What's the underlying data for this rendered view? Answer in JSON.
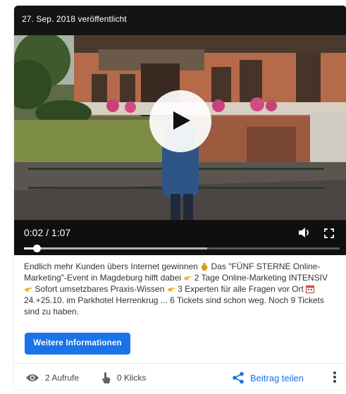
{
  "post": {
    "date_label": "27. Sep. 2018 veröffentlicht",
    "description_parts": {
      "p1": "Endlich mehr Kunden übers Internet gewinnen",
      "p2": "Das \"FÜNF STERNE Online-Marketing\"-Event in Magdeburg hilft dabei",
      "p3": "2 Tage Online-Marketing INTENSIV",
      "p4": "Sofort umsetzbares Praxis-Wissen",
      "p5": "3 Experten für alle Fragen vor Ort",
      "p6": "24.+25.10. im Parkhotel Herrenkrug ... 6 Tickets sind schon weg. Noch 9 Tickets sind zu haben."
    },
    "cta_label": "Weitere Informationen"
  },
  "video": {
    "timecode": "0:02 / 1:07",
    "progress_fraction": 0.03,
    "buffered_fraction": 0.58
  },
  "footer": {
    "views_label": "2 Aufrufe",
    "clicks_label": "0 Klicks",
    "share_label": "Beitrag teilen"
  },
  "colors": {
    "accent": "#1a73e8",
    "video_bg": "#0f0f10"
  },
  "icons": [
    "play-icon",
    "volume-icon",
    "fullscreen-icon",
    "eye-icon",
    "pointer-hand-icon",
    "share-icon",
    "more-vert-icon",
    "moneybag-icon",
    "pointing-hand-icon",
    "calendar-icon"
  ]
}
